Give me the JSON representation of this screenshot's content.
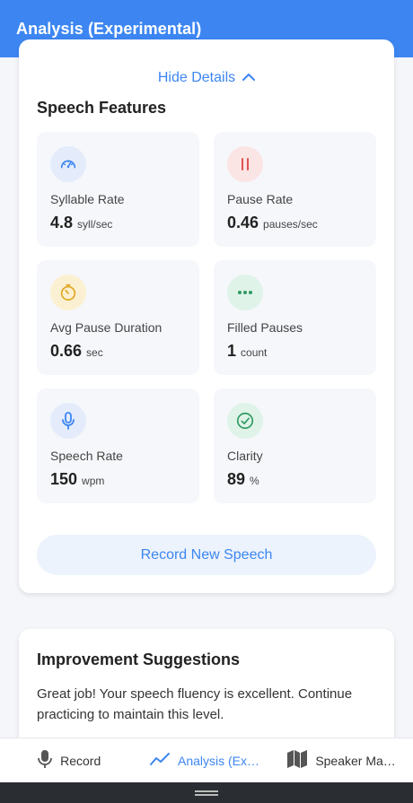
{
  "header": {
    "title": "Analysis (Experimental)"
  },
  "details_toggle": {
    "label": "Hide Details",
    "icon": "chevron-up-icon"
  },
  "speech_features": {
    "title": "Speech Features",
    "items": [
      {
        "label": "Syllable Rate",
        "value": "4.8",
        "unit": "syll/sec",
        "icon": "speedometer-icon",
        "color": "#3d86f2",
        "bg": "#e4ecfb"
      },
      {
        "label": "Pause Rate",
        "value": "0.46",
        "unit": "pauses/sec",
        "icon": "pause-icon",
        "color": "#e05252",
        "bg": "#fbe4e4"
      },
      {
        "label": "Avg Pause Duration",
        "value": "0.66",
        "unit": "sec",
        "icon": "timer-icon",
        "color": "#e0a820",
        "bg": "#fcf0d2"
      },
      {
        "label": "Filled Pauses",
        "value": "1",
        "unit": "count",
        "icon": "dots-icon",
        "color": "#2e9a62",
        "bg": "#dff3e8"
      },
      {
        "label": "Speech Rate",
        "value": "150",
        "unit": "wpm",
        "icon": "microphone-icon",
        "color": "#3d86f2",
        "bg": "#e4ecfb"
      },
      {
        "label": "Clarity",
        "value": "89",
        "unit": "%",
        "icon": "check-circle-icon",
        "color": "#2e9a62",
        "bg": "#dff3e8"
      }
    ]
  },
  "record_button": {
    "label": "Record New Speech"
  },
  "suggestions": {
    "title": "Improvement Suggestions",
    "text": "Great job! Your speech fluency is excellent. Continue practicing to maintain this level."
  },
  "bottom_nav": {
    "items": [
      {
        "label": "Record",
        "icon": "microphone-icon"
      },
      {
        "label": "Analysis (Experimental)",
        "icon": "trend-line-icon",
        "active": true
      },
      {
        "label": "Speaker Map (Experimental)",
        "icon": "map-icon"
      }
    ]
  },
  "colors": {
    "accent": "#3d86f2"
  }
}
